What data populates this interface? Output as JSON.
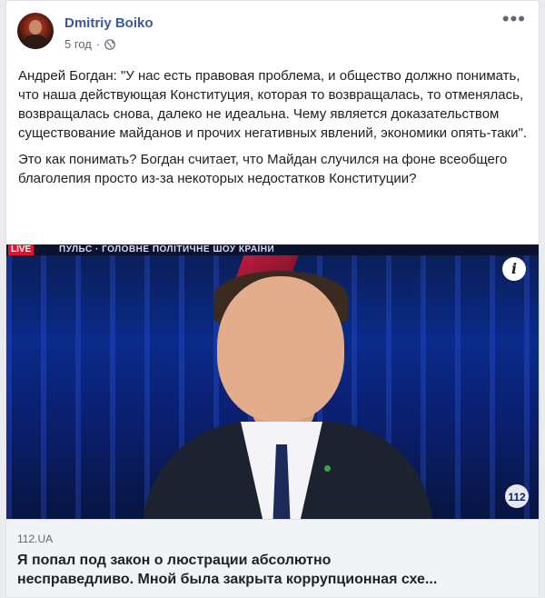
{
  "post": {
    "author": "Dmitriy Boiko",
    "time": "5 год",
    "separator": "·",
    "privacy_icon": "globe-icon",
    "more_icon": "ellipsis-icon",
    "text_paragraph_1": "Андрей Богдан: \"У нас есть правовая проблема, и общество должно понимать, что наша действующая Конституция, которая то возвращалась, то отменялась, возвращалась снова, далеко не идеальна. Чему является доказательством существование майданов и прочих негативных явлений, экономики опять-таки\".",
    "text_paragraph_2": "Это как понимать? Богдан считает, что Майдан случился на фоне всеобщего благолепия просто из-за некоторых недостатков Конституции?"
  },
  "link_preview": {
    "ticker_live": "LIVE",
    "ticker_text": "ПУЛЬС · ГОЛОВНЕ ПОЛІТИЧНЕ ШОУ КРАЇНИ",
    "channel_logo": "112",
    "info_icon": "info-icon",
    "domain": "112.UA",
    "title_line_1": "Я попал под закон о люстрации абсолютно",
    "title_line_2": "несправедливо. Мной была закрыта коррупционная схе..."
  },
  "colors": {
    "author": "#385898",
    "meta": "#616770",
    "text": "#1c1e21",
    "caption_bg": "#f2f3f5"
  }
}
